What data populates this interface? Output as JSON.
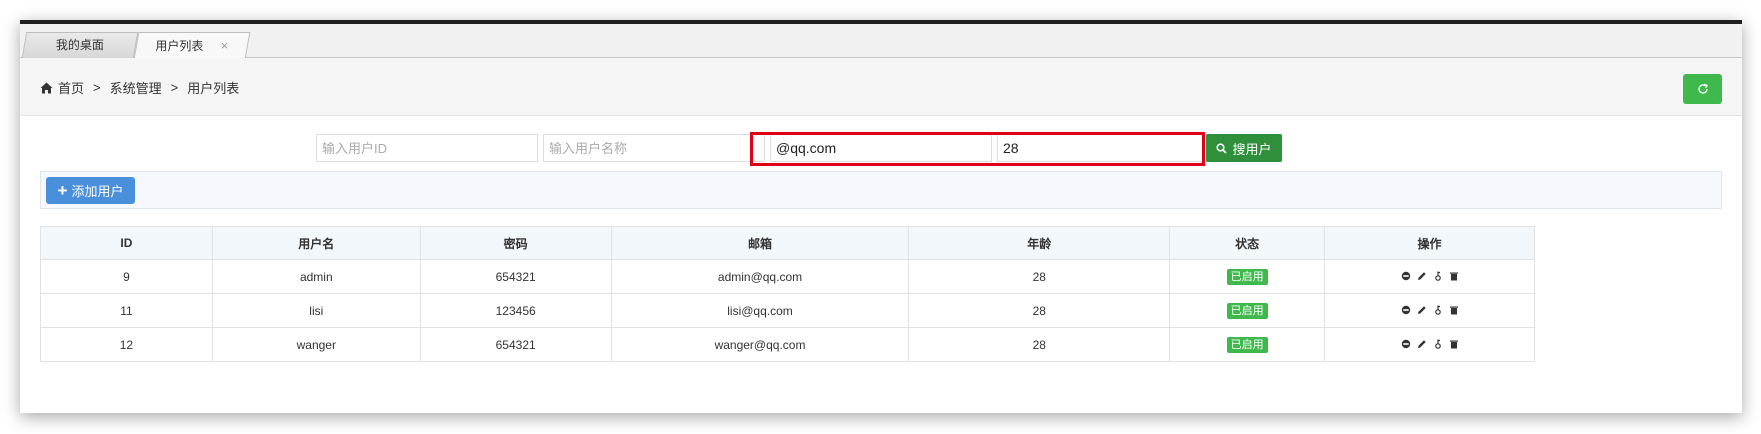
{
  "tabs": [
    {
      "label": "我的桌面"
    },
    {
      "label": "用户列表",
      "close": "×"
    }
  ],
  "breadcrumb": {
    "home": "首页",
    "separator": ">",
    "level1": "系统管理",
    "level2": "用户列表"
  },
  "search": {
    "user_id": {
      "placeholder": "输入用户ID",
      "value": ""
    },
    "user_name": {
      "placeholder": "输入用户名称",
      "value": ""
    },
    "email": {
      "value": "@qq.com"
    },
    "age": {
      "value": "28"
    },
    "button_label": "搜用户"
  },
  "toolbar": {
    "add_label": "添加用户"
  },
  "table": {
    "headers": [
      "ID",
      "用户名",
      "密码",
      "邮箱",
      "年龄",
      "状态",
      "操作"
    ],
    "rows": [
      {
        "id": "9",
        "username": "admin",
        "password": "654321",
        "email": "admin@qq.com",
        "age": "28",
        "status": "已启用"
      },
      {
        "id": "11",
        "username": "lisi",
        "password": "123456",
        "email": "lisi@qq.com",
        "age": "28",
        "status": "已启用"
      },
      {
        "id": "12",
        "username": "wanger",
        "password": "654321",
        "email": "wanger@qq.com",
        "age": "28",
        "status": "已启用"
      }
    ],
    "action_icons": [
      "disable-icon",
      "edit-icon",
      "key-icon",
      "delete-icon"
    ]
  },
  "colors": {
    "accent_green": "#3fb94b",
    "search_green": "#2f8f3a",
    "add_blue": "#4a8fdb",
    "highlight_red": "#e00018"
  }
}
